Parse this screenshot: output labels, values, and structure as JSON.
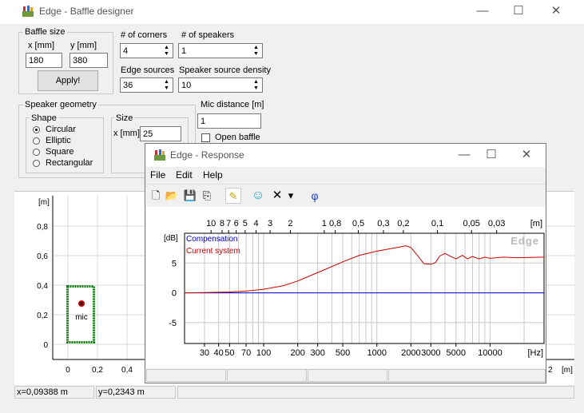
{
  "main_window": {
    "title": "Edge - Baffle designer",
    "controls": {
      "minimize": "—",
      "maximize": "☐",
      "close": "✕"
    },
    "baffle_size": {
      "group_label": "Baffle size",
      "x_label": "x [mm]",
      "y_label": "y [mm]",
      "x_value": "180",
      "y_value": "380",
      "apply_label": "Apply!"
    },
    "corners": {
      "label": "# of corners",
      "value": "4"
    },
    "speakers": {
      "label": "# of speakers",
      "value": "1"
    },
    "edge_sources": {
      "label": "Edge sources",
      "value": "36"
    },
    "speaker_density": {
      "label": "Speaker source density",
      "value": "10"
    },
    "speaker_geometry": {
      "group_label": "Speaker geometry",
      "shape_label": "Shape",
      "shapes": [
        "Circular",
        "Elliptic",
        "Square",
        "Rectangular"
      ],
      "selected_shape": "Circular",
      "size_label": "Size",
      "size_x_label": "x [mm]",
      "size_x_value": "25"
    },
    "mic_distance": {
      "label": "Mic distance [m]",
      "value": "1"
    },
    "open_baffle": {
      "label": "Open baffle",
      "checked": false
    },
    "plot": {
      "y_unit": "[m]",
      "x_unit": "[m]",
      "y_ticks": [
        "0,8",
        "0,6",
        "0,4",
        "0,2",
        "0"
      ],
      "x_ticks": [
        "0",
        "0,2",
        "0,4"
      ],
      "x_tick_right": "2",
      "mic_label": "mic"
    },
    "status": {
      "x": "x=0,09388 m",
      "y": "y=0,2343 m"
    }
  },
  "response_window": {
    "title": "Edge - Response",
    "controls": {
      "minimize": "—",
      "maximize": "☐",
      "close": "✕"
    },
    "menu": [
      "File",
      "Edit",
      "Help"
    ],
    "toolbar": {
      "new": "🗋",
      "open": "📂",
      "save": "💾",
      "copy": "⎘",
      "pen": "✎",
      "person": "☺",
      "delete": "✕",
      "dropdown": "▾",
      "phi": "φ"
    }
  },
  "chart_data": {
    "type": "line",
    "watermark": "Edge",
    "ylabel": "[dB]",
    "xlabel": "[Hz]",
    "top_axis_label": "[m]",
    "x_scale": "log",
    "xlim": [
      20,
      30000
    ],
    "ylim": [
      -8.5,
      10
    ],
    "y_ticks": [
      5,
      0,
      -5
    ],
    "x_ticks": [
      30,
      40,
      50,
      70,
      100,
      200,
      300,
      500,
      1000,
      2000,
      3000,
      5000,
      10000
    ],
    "x_tick_labels": [
      "30",
      "40",
      "50",
      "70",
      "100",
      "200",
      "300",
      "500",
      "1000",
      "2000",
      "3000",
      "5000",
      "10000"
    ],
    "top_ticks": [
      {
        "label": "10",
        "hz": 34.3
      },
      {
        "label": "8",
        "hz": 42.9
      },
      {
        "label": "7",
        "hz": 49
      },
      {
        "label": "6",
        "hz": 57.2
      },
      {
        "label": "5",
        "hz": 68.6
      },
      {
        "label": "4",
        "hz": 85.8
      },
      {
        "label": "3",
        "hz": 114
      },
      {
        "label": "2",
        "hz": 172
      },
      {
        "label": "1",
        "hz": 343
      },
      {
        "label": "0,8",
        "hz": 429
      },
      {
        "label": "0,5",
        "hz": 686
      },
      {
        "label": "0,3",
        "hz": 1143
      },
      {
        "label": "0,2",
        "hz": 1715
      },
      {
        "label": "0,1",
        "hz": 3430
      },
      {
        "label": "0,05",
        "hz": 6860
      },
      {
        "label": "0,03",
        "hz": 11433
      }
    ],
    "grid": true,
    "legend": "top-left",
    "series": [
      {
        "name": "Compensation",
        "color": "#0000cc",
        "points": [
          [
            20,
            0
          ],
          [
            30000,
            0
          ]
        ]
      },
      {
        "name": "Current system",
        "color": "#cc0000",
        "points": [
          [
            20,
            0
          ],
          [
            30,
            0.05
          ],
          [
            50,
            0.15
          ],
          [
            70,
            0.3
          ],
          [
            100,
            0.6
          ],
          [
            150,
            1.2
          ],
          [
            200,
            2
          ],
          [
            300,
            3.4
          ],
          [
            500,
            5.2
          ],
          [
            700,
            6.3
          ],
          [
            1000,
            7
          ],
          [
            1500,
            7.6
          ],
          [
            1800,
            7.9
          ],
          [
            2000,
            7.6
          ],
          [
            2300,
            6.2
          ],
          [
            2600,
            4.9
          ],
          [
            3000,
            4.8
          ],
          [
            3300,
            5.1
          ],
          [
            3600,
            6.2
          ],
          [
            4000,
            6.6
          ],
          [
            4500,
            6.1
          ],
          [
            5000,
            5.7
          ],
          [
            5700,
            6.3
          ],
          [
            6300,
            5.7
          ],
          [
            7000,
            6.1
          ],
          [
            8000,
            5.7
          ],
          [
            9000,
            6
          ],
          [
            10000,
            5.8
          ],
          [
            13000,
            6
          ],
          [
            17000,
            5.9
          ],
          [
            30000,
            6
          ]
        ]
      }
    ]
  }
}
